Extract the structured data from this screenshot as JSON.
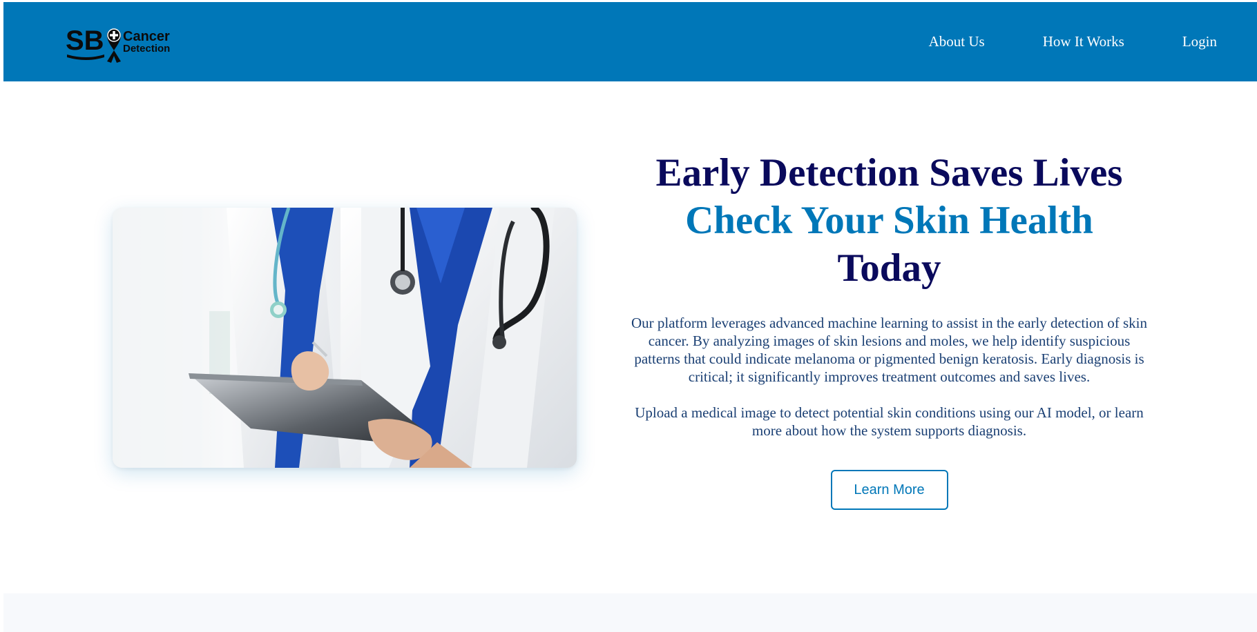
{
  "brand": {
    "initials": "SB",
    "line1": "Cancer",
    "line2": "Detection",
    "color_primary": "#0077b8",
    "icon": "ribbon-cross-icon"
  },
  "nav": {
    "items": [
      {
        "label": "About Us"
      },
      {
        "label": "How It Works"
      },
      {
        "label": "Login"
      }
    ]
  },
  "hero": {
    "image_icon": "doctor-with-clipboard-photo",
    "headline_line1": "Early Detection Saves Lives",
    "headline_line2": "Check Your Skin Health",
    "headline_line3": "Today",
    "paragraph1": "Our platform leverages advanced machine learning to assist in the early detection of skin cancer. By analyzing images of skin lesions and moles, we help identify suspicious patterns that could indicate melanoma or pigmented benign keratosis. Early diagnosis is critical; it significantly improves treatment outcomes and saves lives.",
    "paragraph2": "Upload a medical image to detect potential skin conditions using our AI model, or learn more about how the system supports diagnosis.",
    "cta_label": "Learn More"
  },
  "colors": {
    "navbar": "#0077b8",
    "headline_dark": "#0a0a5c",
    "headline_accent": "#0077b8",
    "body_text": "#1a3f73",
    "section_bg": "#f7f9fc"
  }
}
